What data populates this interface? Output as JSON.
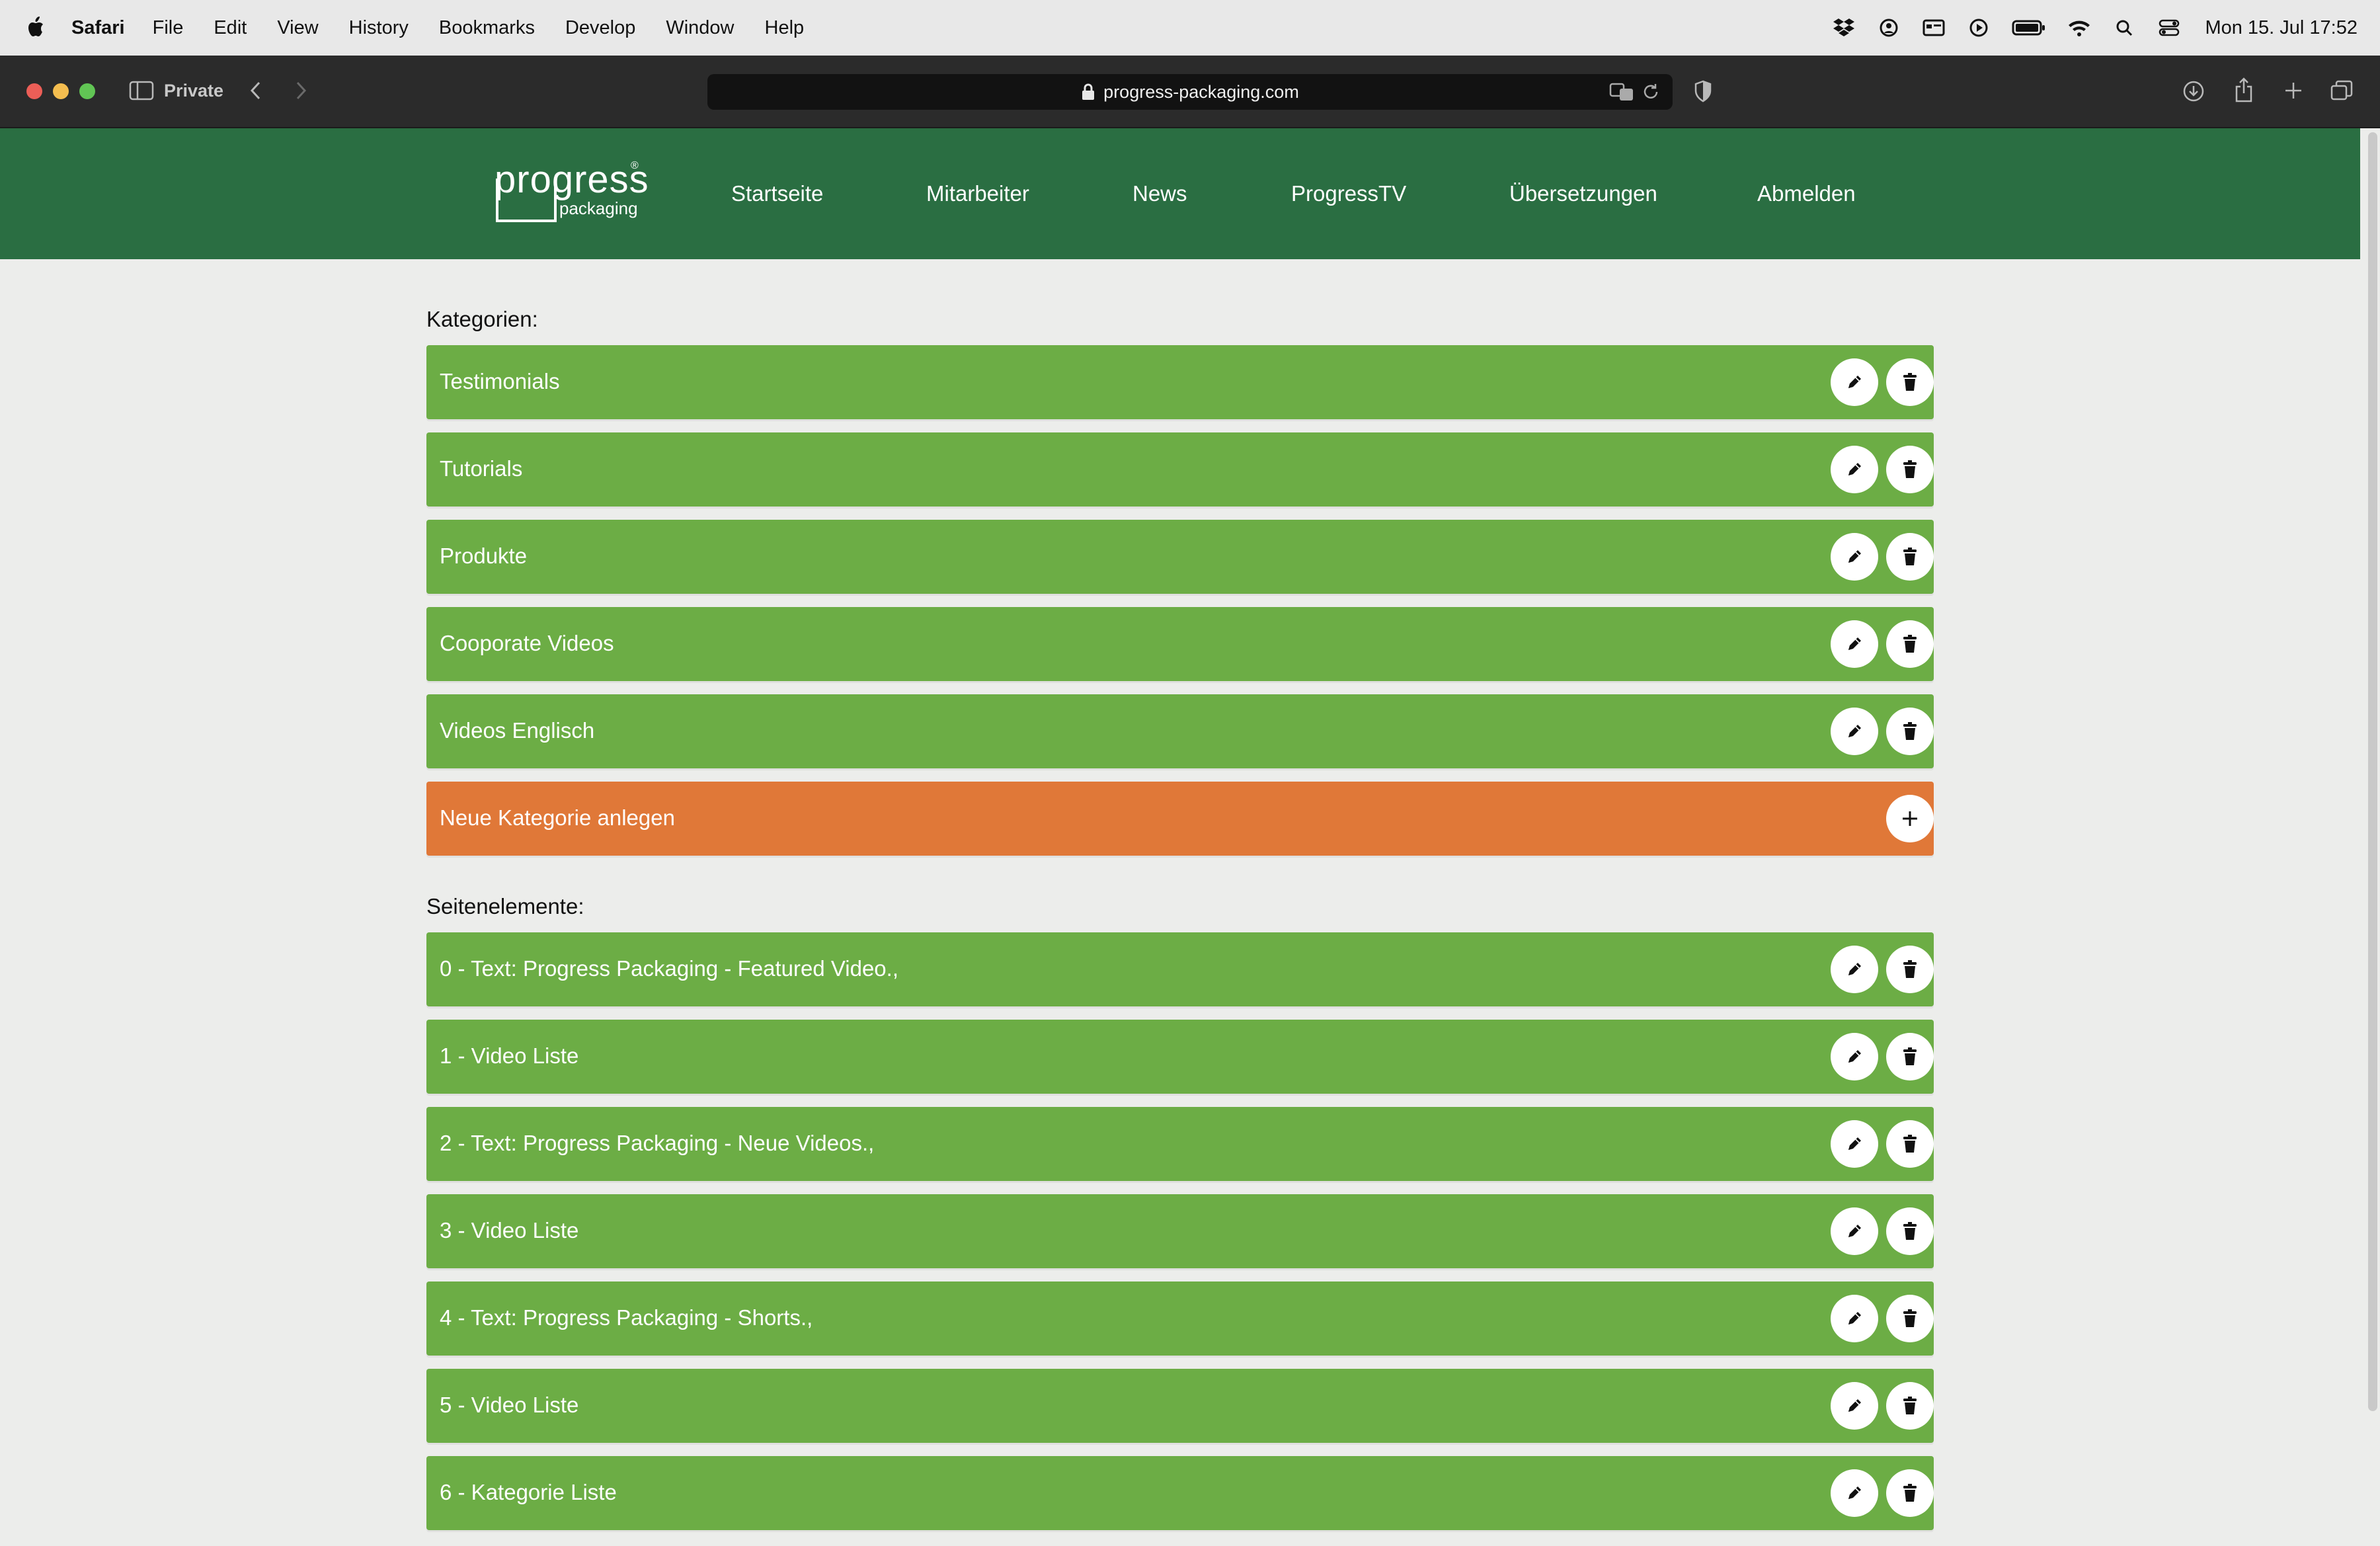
{
  "menubar": {
    "apple_icon": "apple-logo-icon",
    "app_name": "Safari",
    "items": [
      "File",
      "Edit",
      "View",
      "History",
      "Bookmarks",
      "Develop",
      "Window",
      "Help"
    ],
    "status_icons": [
      "dropbox-icon",
      "user-circle-icon",
      "card-icon",
      "play-icon",
      "battery-icon",
      "wifi-icon",
      "search-icon",
      "control-center-icon"
    ],
    "clock": "Mon 15. Jul  17:52"
  },
  "browser": {
    "private_label": "Private",
    "url": "progress-packaging.com"
  },
  "site": {
    "logo": {
      "word": "progress",
      "sub": "packaging",
      "reg": "®"
    },
    "nav": [
      "Startseite",
      "Mitarbeiter",
      "News",
      "ProgressTV",
      "Übersetzungen",
      "Abmelden"
    ]
  },
  "categories": {
    "title": "Kategorien:",
    "items": [
      "Testimonials",
      "Tutorials",
      "Produkte",
      "Cooporate Videos",
      "Videos Englisch"
    ],
    "add_label": "Neue Kategorie anlegen"
  },
  "elements": {
    "title": "Seitenelemente:",
    "items": [
      "0 - Text: Progress Packaging - Featured Video.,",
      "1 - Video Liste",
      "2 - Text: Progress Packaging - Neue Videos.,",
      "3 - Video Liste",
      "4 - Text: Progress Packaging - Shorts.,",
      "5 - Video Liste",
      "6 - Kategorie Liste"
    ]
  },
  "colors": {
    "header_green": "#2a6e42",
    "row_green": "#6cad45",
    "add_orange": "#e07838",
    "page_bg": "#ecedeb"
  }
}
